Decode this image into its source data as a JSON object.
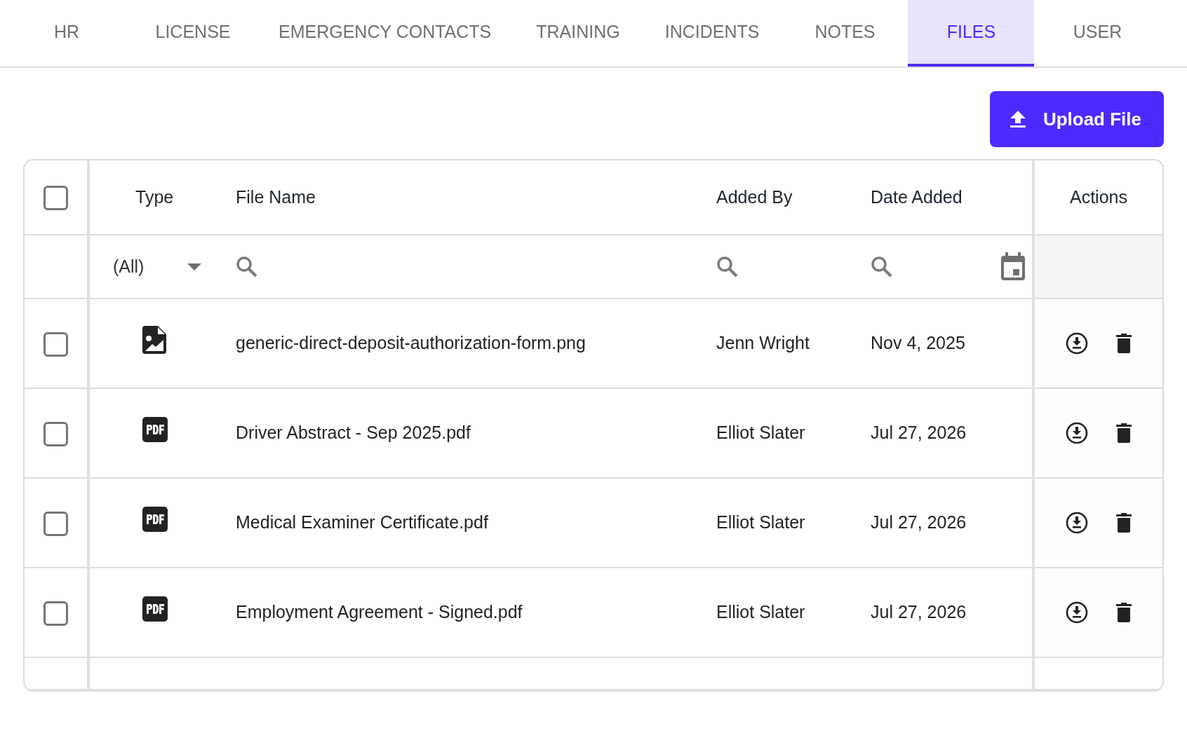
{
  "tabs": [
    {
      "label": "HR",
      "selected": false
    },
    {
      "label": "LICENSE",
      "selected": false
    },
    {
      "label": "EMERGENCY CONTACTS",
      "selected": false
    },
    {
      "label": "TRAINING",
      "selected": false
    },
    {
      "label": "INCIDENTS",
      "selected": false
    },
    {
      "label": "NOTES",
      "selected": false
    },
    {
      "label": "FILES",
      "selected": true
    },
    {
      "label": "USER",
      "selected": false
    }
  ],
  "upload_button": {
    "label": "Upload File"
  },
  "table": {
    "select_all": {
      "checked": false
    },
    "columns": [
      "Type",
      "File Name",
      "Added By",
      "Date Added",
      "Actions"
    ],
    "filters": {
      "type": {
        "value": "(All)"
      }
    },
    "rows": [
      {
        "checked": false,
        "kind": "image",
        "file_name": "generic-direct-deposit-authorization-form.png",
        "added_by": "Jenn Wright",
        "date_added": "Nov 4, 2025"
      },
      {
        "checked": false,
        "kind": "pdf",
        "file_name": "Driver Abstract - Sep 2025.pdf",
        "added_by": "Elliot Slater",
        "date_added": "Jul 27, 2026"
      },
      {
        "checked": false,
        "kind": "pdf",
        "file_name": "Medical Examiner Certificate.pdf",
        "added_by": "Elliot Slater",
        "date_added": "Jul 27, 2026"
      },
      {
        "checked": false,
        "kind": "pdf",
        "file_name": "Employment Agreement - Signed.pdf",
        "added_by": "Elliot Slater",
        "date_added": "Jul 27, 2026"
      }
    ]
  }
}
